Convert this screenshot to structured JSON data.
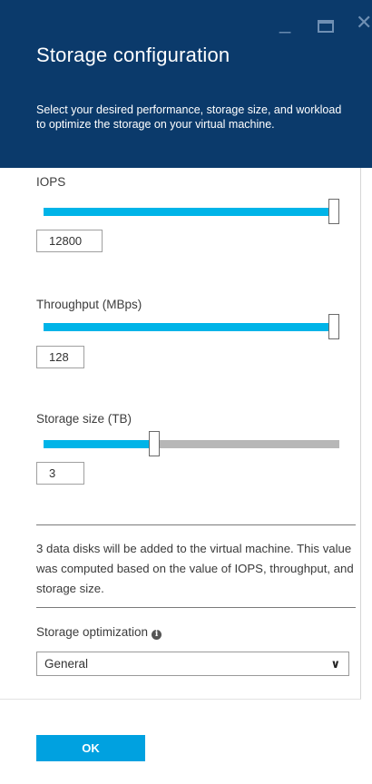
{
  "window": {
    "minimize_icon": "minimize-icon",
    "maximize_icon": "maximize-icon",
    "close_icon": "close-icon"
  },
  "header": {
    "title": "Storage configuration",
    "subtitle": "Select your desired performance, storage size, and workload to optimize the storage on your virtual machine."
  },
  "iops": {
    "label": "IOPS",
    "value": "12800",
    "fill_fraction": 1.0
  },
  "throughput": {
    "label": "Throughput (MBps)",
    "value": "128",
    "fill_fraction": 1.0
  },
  "storage_size": {
    "label": "Storage size (TB)",
    "value": "3",
    "fill_fraction": 0.37
  },
  "info": {
    "text": "3 data disks will be added to the virtual machine. This value was computed based on the value of IOPS, throughput, and storage size."
  },
  "optimization": {
    "label": "Storage optimization",
    "info_icon": "info-icon",
    "selected": "General",
    "chevron_icon": "chevron-down-icon"
  },
  "footer": {
    "ok_label": "OK"
  },
  "colors": {
    "header_bg": "#0b3a6b",
    "slider_fill": "#00b4e8",
    "slider_track": "#b7b7b7",
    "button_bg": "#00a1e0"
  }
}
